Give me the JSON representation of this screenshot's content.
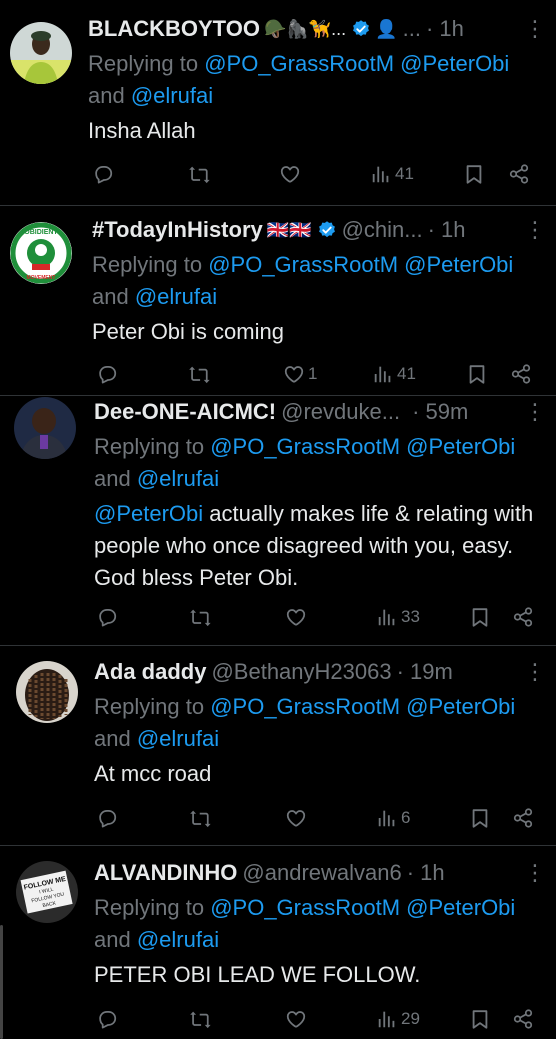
{
  "replying_prefix": "Replying to",
  "replying_and": "and",
  "tweets": [
    {
      "name": "BLACKBOYTOO",
      "emojis": "🪖🦍🦮...",
      "handle": "...",
      "time": "· 1h",
      "mentions": [
        "@PO_GrassRootM",
        "@PeterObi",
        "@elrufai"
      ],
      "text": "Insha Allah",
      "counts": {
        "reply": "",
        "retweet": "",
        "like": "",
        "views": "41"
      }
    },
    {
      "name": "#TodayInHistory",
      "emojis": "🇬🇧🇬🇧",
      "handle": "@chin...",
      "time": "· 1h",
      "mentions": [
        "@PO_GrassRootM",
        "@PeterObi",
        "@elrufai"
      ],
      "text": "Peter Obi is coming",
      "counts": {
        "reply": "",
        "retweet": "",
        "like": "1",
        "views": "41"
      }
    },
    {
      "name": "Dee-ONE-AICMC!",
      "emojis": "",
      "handle": "@revduke...",
      "time": "· 59m",
      "mentions": [
        "@PO_GrassRootM",
        "@PeterObi",
        "@elrufai"
      ],
      "text_mention": "@PeterObi",
      "text": " actually makes life & relating with people who once disagreed with you, easy. God bless Peter Obi.",
      "counts": {
        "reply": "",
        "retweet": "",
        "like": "",
        "views": "33"
      }
    },
    {
      "name": "Ada daddy",
      "emojis": "",
      "handle": "@BethanyH23063",
      "time": "· 19m",
      "mentions": [
        "@PO_GrassRootM",
        "@PeterObi",
        "@elrufai"
      ],
      "text": "At mcc road",
      "counts": {
        "reply": "",
        "retweet": "",
        "like": "",
        "views": "6"
      }
    },
    {
      "name": "ALVANDINHO",
      "emojis": "",
      "handle": "@andrewalvan6",
      "time": "· 1h",
      "mentions": [
        "@PO_GrassRootM",
        "@PeterObi",
        "@elrufai"
      ],
      "text": "PETER OBI LEAD WE FOLLOW.",
      "counts": {
        "reply": "",
        "retweet": "",
        "like": "",
        "views": "29"
      }
    }
  ],
  "avatar_texts": {
    "obidient_top": "OBIDIENT",
    "obidient_bottom": "MOVEMENT",
    "sign_line1": "FOLLOW ME",
    "sign_line2": "I WILL",
    "sign_line3": "FOLLOW YOU",
    "sign_line4": "BACK"
  },
  "colors": {
    "background": "#000000",
    "text": "#e7e9ea",
    "muted": "#71767b",
    "link": "#1d9bf0",
    "divider": "#2f3336"
  }
}
